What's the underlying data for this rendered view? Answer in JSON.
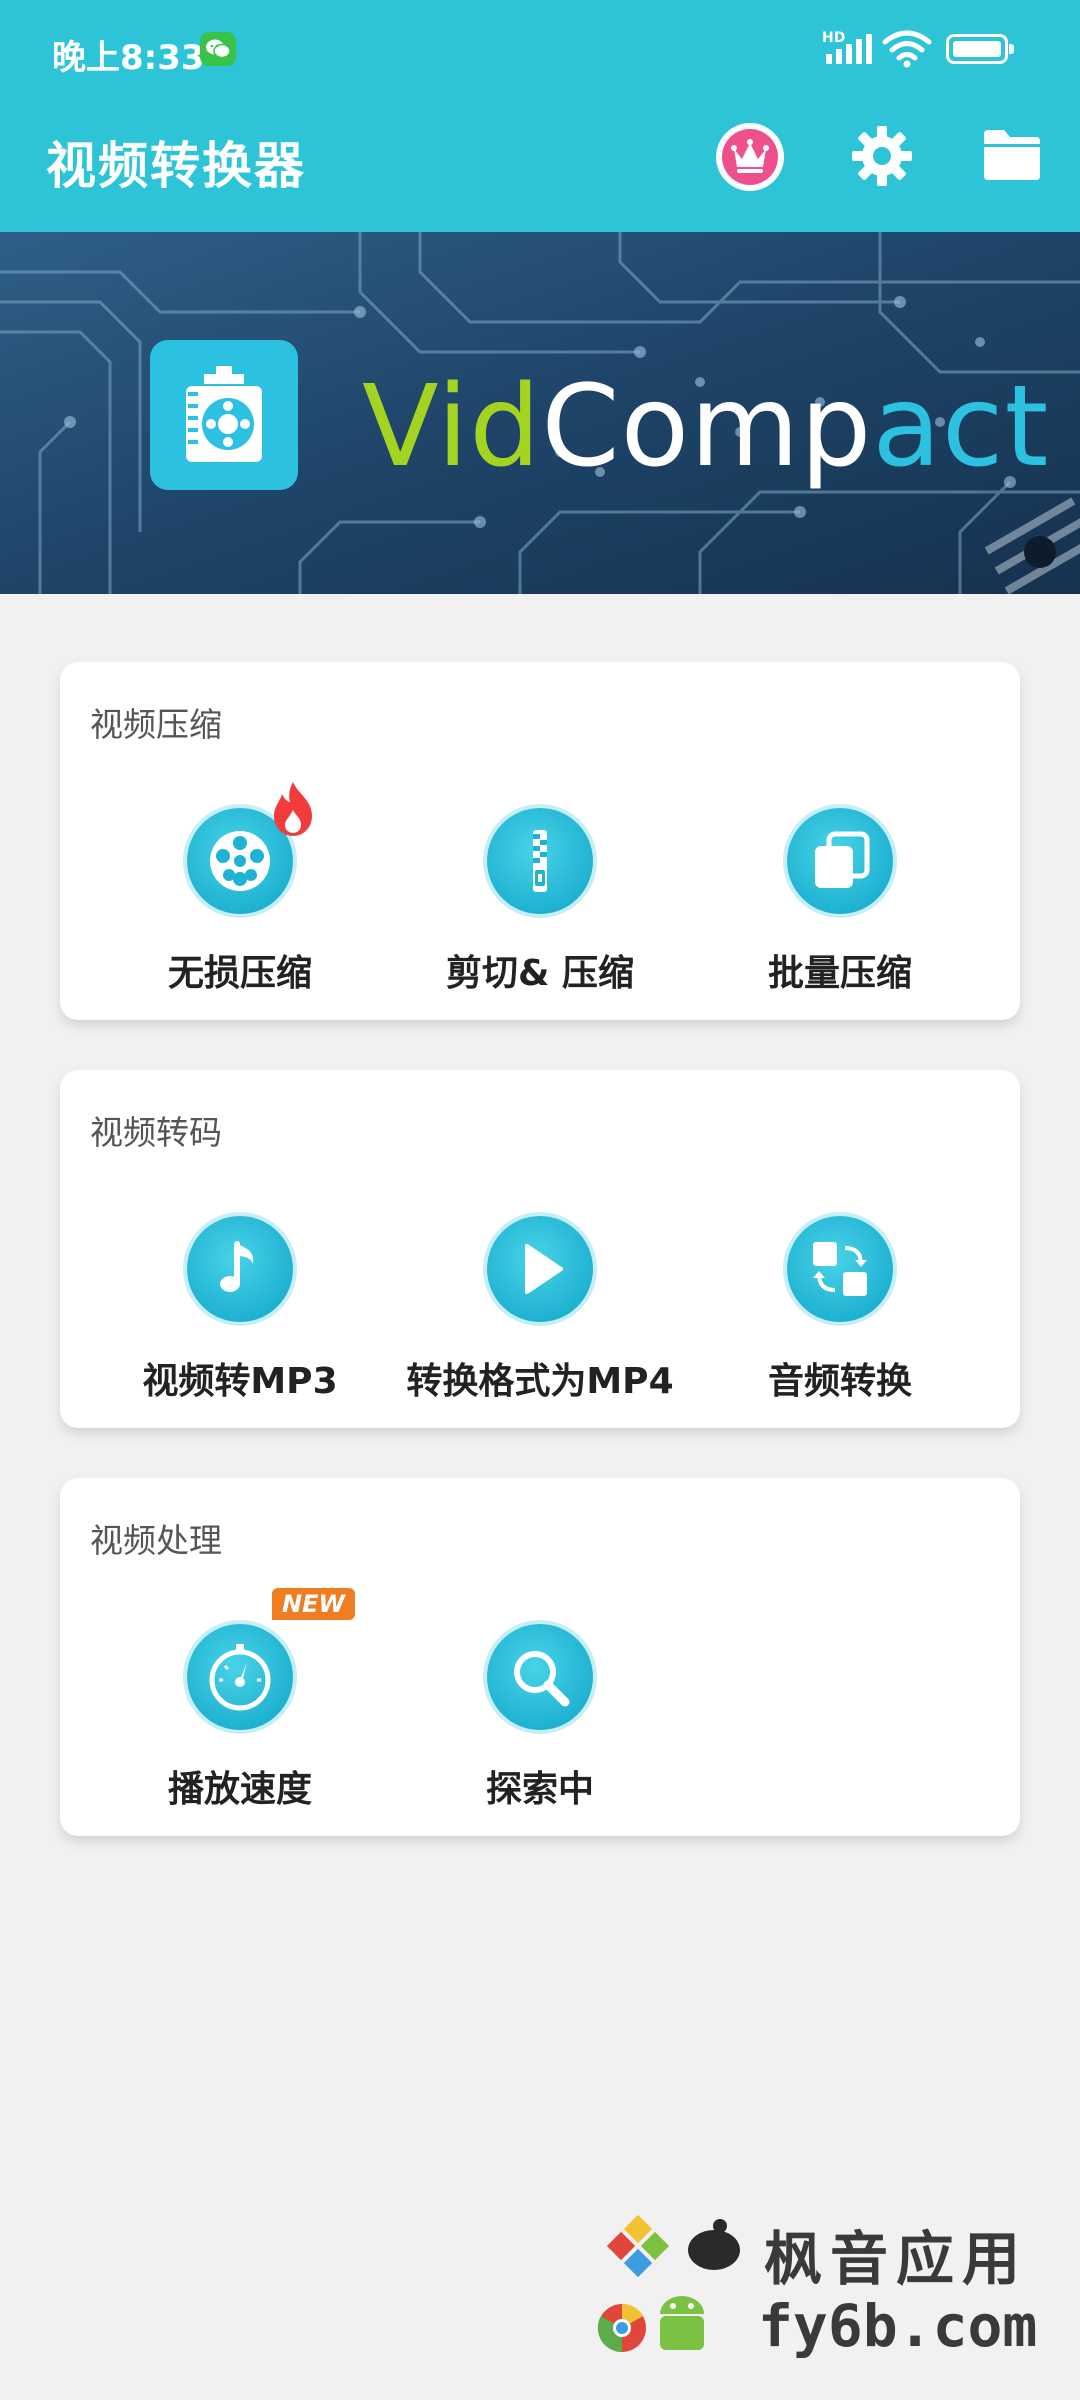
{
  "status_bar": {
    "time": "晚上8:33",
    "network": "HD"
  },
  "app_bar": {
    "title": "视频转换器",
    "actions": [
      "crown-icon",
      "gear-icon",
      "folder-icon"
    ]
  },
  "banner": {
    "brand_part1": "Vid",
    "brand_part2": "Comp",
    "brand_part3": "act"
  },
  "sections": [
    {
      "title": "视频压缩",
      "items": [
        {
          "label": "无损压缩",
          "icon": "film-reel-icon",
          "badge": "fire-icon"
        },
        {
          "label": "剪切& 压缩",
          "icon": "zipper-icon"
        },
        {
          "label": "批量压缩",
          "icon": "copy-stack-icon"
        }
      ]
    },
    {
      "title": "视频转码",
      "items": [
        {
          "label": "视频转MP3",
          "icon": "music-note-icon"
        },
        {
          "label": "转换格式为MP4",
          "icon": "play-icon"
        },
        {
          "label": "音频转换",
          "icon": "convert-arrows-icon"
        }
      ]
    },
    {
      "title": "视频处理",
      "items": [
        {
          "label": "播放速度",
          "icon": "speedometer-icon",
          "badge": "NEW"
        },
        {
          "label": "探索中",
          "icon": "magnifier-icon"
        }
      ]
    }
  ],
  "watermark": {
    "line1": "枫音应用",
    "line2": "fy6b.com"
  },
  "colors": {
    "primary": "#2ec4d8",
    "crown_bg": "#f04f8e",
    "icon_teal": "#1fb2d2",
    "new_badge": "#f07d1f",
    "brand_green": "#a5d321"
  }
}
